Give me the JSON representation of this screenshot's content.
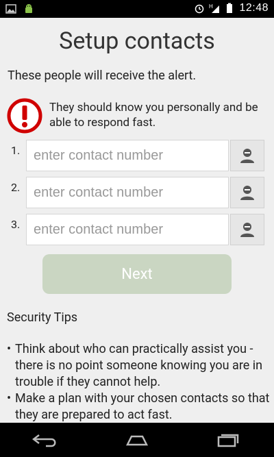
{
  "statusbar": {
    "time": "12:48",
    "icons": [
      "image-icon",
      "android-icon",
      "alarm-icon",
      "network-icon",
      "battery-icon"
    ]
  },
  "title": "Setup contacts",
  "subtitle": "These people will receive the alert.",
  "alert_text": "They should know you personally and be able to respond fast.",
  "contacts": [
    {
      "index": "1.",
      "placeholder": "enter contact number"
    },
    {
      "index": "2.",
      "placeholder": "enter contact number"
    },
    {
      "index": "3.",
      "placeholder": "enter contact number"
    }
  ],
  "next_label": "Next",
  "tips_header": "Security Tips",
  "tips": [
    "Think about who can practically assist you - there is no point someone knowing you are in trouble if they cannot help.",
    "Make a plan with your chosen contacts so that they are prepared to act fast."
  ],
  "navbar": [
    "back-icon",
    "home-icon",
    "recent-apps-icon"
  ],
  "colors": {
    "next_bg": "#cad6c2",
    "alert_red": "#d00000"
  }
}
